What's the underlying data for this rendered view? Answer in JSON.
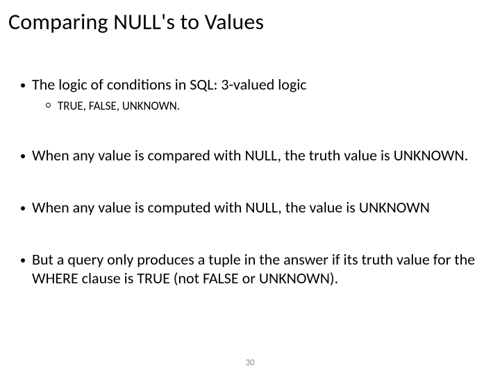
{
  "slide": {
    "title": "Comparing NULL's to Values",
    "bullets": [
      {
        "text": "The logic of conditions in SQL: 3-valued logic",
        "sub": [
          {
            "text": "TRUE, FALSE, UNKNOWN."
          }
        ]
      },
      {
        "text": "When any value is compared with NULL, the truth value is UNKNOWN."
      },
      {
        "text": "When any value is computed with NULL, the value is UNKNOWN"
      },
      {
        "text": "But a query only produces a tuple in the answer if its truth value for the WHERE clause is TRUE (not FALSE or UNKNOWN)."
      }
    ],
    "page_number": "30"
  }
}
